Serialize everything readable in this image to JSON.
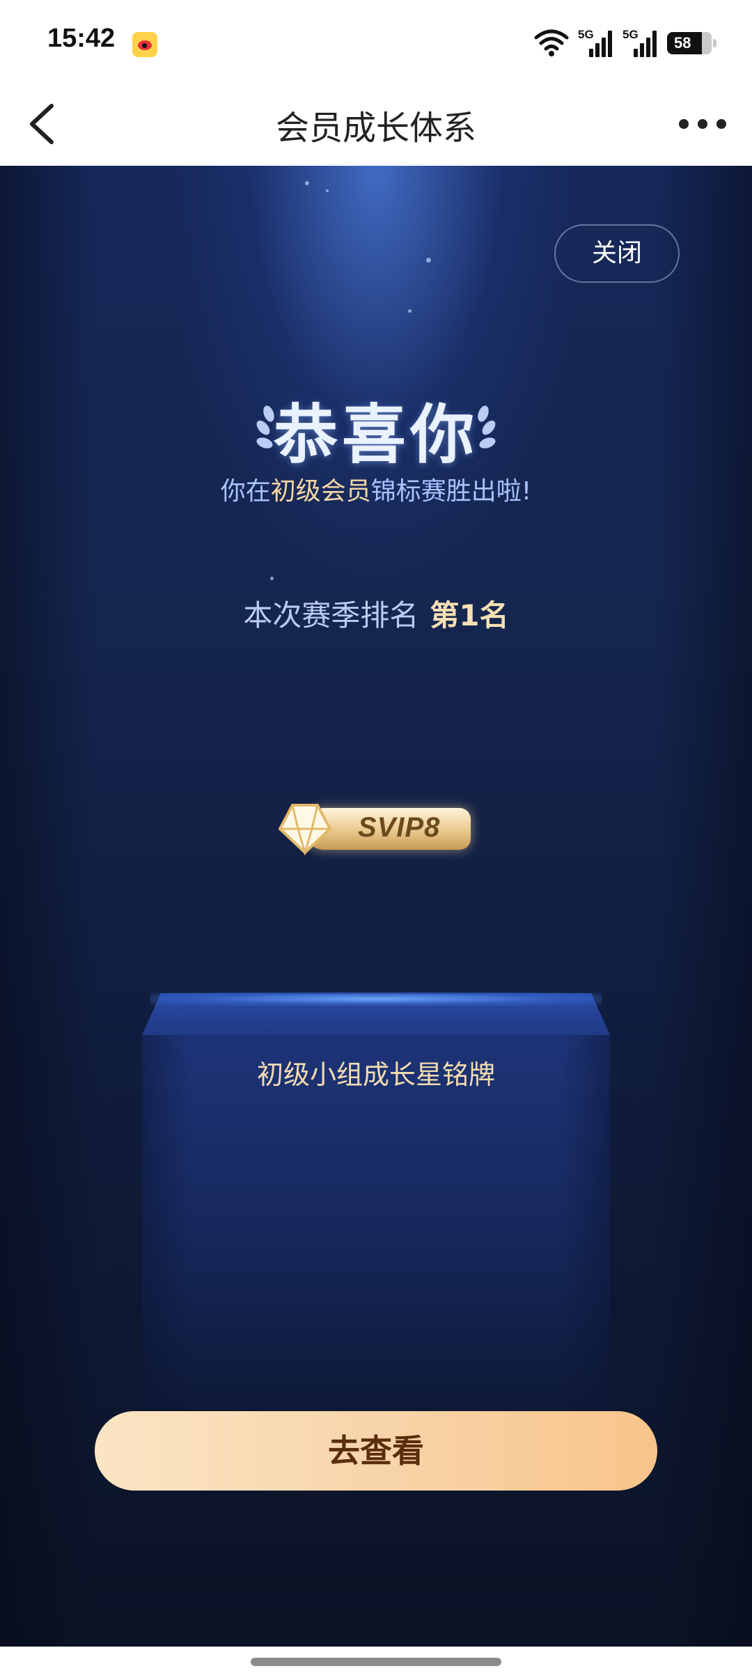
{
  "status_bar": {
    "time": "15:42",
    "battery_level": "58",
    "network": [
      "5G",
      "5G"
    ],
    "icons": [
      "weibo-app-icon",
      "wifi-icon",
      "signal-icon",
      "signal-icon",
      "battery-icon"
    ]
  },
  "nav": {
    "title": "会员成长体系",
    "back_icon": "chevron-left-icon",
    "more_icon": "more-dots-icon"
  },
  "popup": {
    "close_label": "关闭",
    "title": "恭喜你",
    "subtitle_parts": [
      "你在",
      "初级会员",
      "锦标赛胜出啦!"
    ],
    "rank_label": "本次赛季排名",
    "rank_value": "第1名",
    "badge_label": "SVIP8",
    "prize_name": "初级小组成长星铭牌",
    "cta_label": "去查看"
  },
  "colors": {
    "background_top": "#16285a",
    "background_bottom": "#0b1326",
    "accent_gold": "#f7e0b5",
    "subtitle_blue": "#a9c3ff",
    "cta_start": "#fbe5c4",
    "cta_end": "#f9c48a",
    "cta_text": "#5a2d0c"
  }
}
